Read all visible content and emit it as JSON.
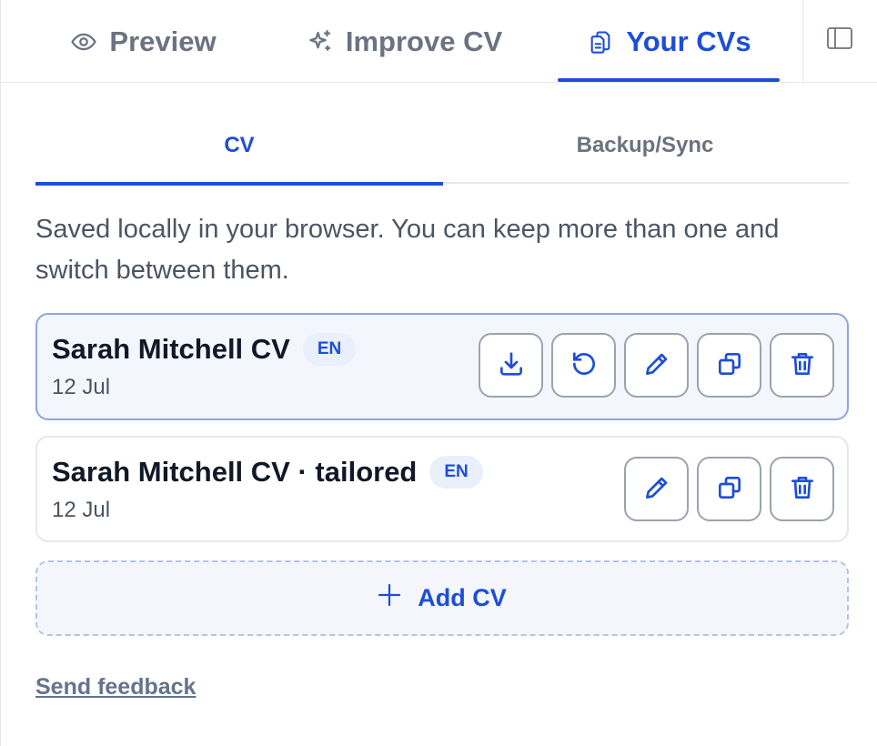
{
  "top_tabs": {
    "preview": {
      "label": "Preview",
      "icon": "eye-icon"
    },
    "improve": {
      "label": "Improve CV",
      "icon": "sparkles-icon"
    },
    "your_cvs": {
      "label": "Your CVs",
      "icon": "documents-icon",
      "active": true
    }
  },
  "sidebar_toggle": {
    "icon": "sidebar-panel-icon"
  },
  "sub_tabs": {
    "cv": {
      "label": "CV",
      "active": true
    },
    "backup": {
      "label": "Backup/Sync"
    }
  },
  "description": "Saved locally in your browser. You can keep more than one and switch between them.",
  "cvs": [
    {
      "title": "Sarah Mitchell CV",
      "lang": "EN",
      "date": "12 Jul",
      "selected": true,
      "actions": [
        "download-icon",
        "restore-icon",
        "pencil-icon",
        "duplicate-icon",
        "trash-icon"
      ]
    },
    {
      "title": "Sarah Mitchell CV · tailored",
      "lang": "EN",
      "date": "12 Jul",
      "selected": false,
      "actions": [
        "pencil-icon",
        "duplicate-icon",
        "trash-icon"
      ]
    }
  ],
  "add_cv": {
    "label": "Add CV",
    "icon": "plus-icon"
  },
  "feedback": {
    "label": "Send feedback"
  },
  "colors": {
    "accent": "#1d4ed8",
    "muted_text": "#6b7280",
    "selected_card_bg": "#f3f6fd",
    "selected_card_border": "#8ea6e0",
    "badge_bg": "#e9effb"
  }
}
